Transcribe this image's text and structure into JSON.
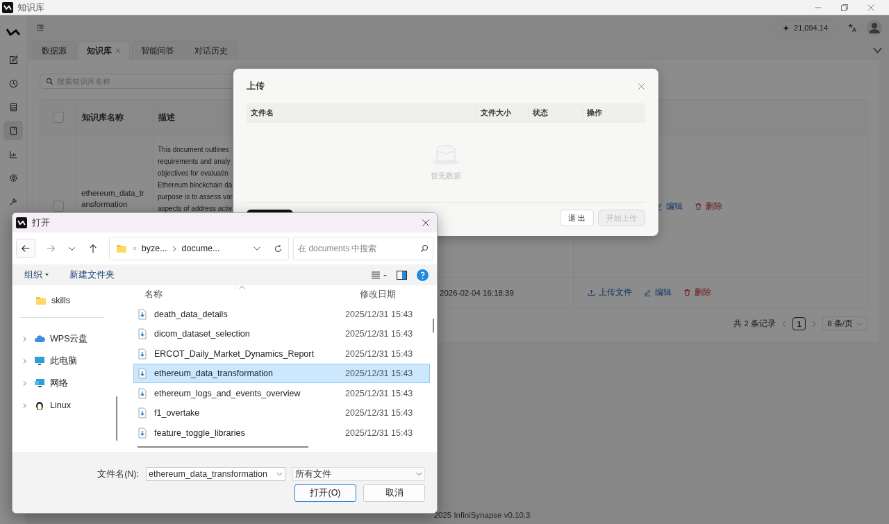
{
  "window": {
    "title": "知识库"
  },
  "rail": {
    "items": [
      {
        "kind": "edit",
        "selected": false
      },
      {
        "kind": "history",
        "selected": false
      },
      {
        "kind": "list",
        "selected": false
      },
      {
        "kind": "book",
        "selected": true
      },
      {
        "kind": "chart",
        "selected": false
      },
      {
        "kind": "settings",
        "selected": false
      },
      {
        "kind": "tools",
        "selected": false
      }
    ]
  },
  "header": {
    "credits": "21,094.14"
  },
  "tabs": [
    {
      "label": "数据源",
      "selected": false,
      "closable": false
    },
    {
      "label": "知识库",
      "selected": true,
      "closable": true
    },
    {
      "label": "智能问答",
      "selected": false,
      "closable": false
    },
    {
      "label": "对话历史",
      "selected": false,
      "closable": false
    }
  ],
  "search": {
    "placeholder": "搜索知识库名称"
  },
  "table": {
    "all_checked": false,
    "columns": [
      "知识库名称",
      "描述"
    ],
    "rows": [
      {
        "checked": false,
        "name": "ethereum_data_transformation",
        "description_lines": [
          "This document outlines",
          "requirements and analy",
          "objectives for evaluatin",
          "Ethereum blockchain da",
          "purpose is to assess var",
          "aspects of address activ"
        ],
        "actions": [
          {
            "kind": "edit",
            "label": "编辑"
          },
          {
            "kind": "delete",
            "label": "删除"
          }
        ]
      },
      {
        "updated": "2026-02-04 16:18:39",
        "actions": [
          {
            "kind": "upload",
            "label": "上传文件"
          },
          {
            "kind": "edit",
            "label": "编辑"
          },
          {
            "kind": "delete",
            "label": "删除"
          }
        ]
      }
    ]
  },
  "pagination": {
    "total": "共 2 条记录",
    "pages": [
      {
        "label": "1",
        "selected": true
      }
    ],
    "page_size": "8 条/页"
  },
  "footer": "2025 InfiniSynapse v0.10.3",
  "upload_dialog": {
    "title": "上传",
    "columns": [
      "文件名",
      "文件大小",
      "状态",
      "操作"
    ],
    "empty_text": "暂无数据",
    "buttons": [
      {
        "label": "退 出",
        "disabled": false
      },
      {
        "label": "开始上传",
        "disabled": true
      }
    ]
  },
  "open_dialog": {
    "title": "打开",
    "path": [
      "byze...",
      "docume..."
    ],
    "search_placeholder": "在 documents 中搜索",
    "toolbar": [
      "组织",
      "新建文件夹"
    ],
    "nav": [
      {
        "kind": "folder",
        "label": "skills",
        "expandable": false
      },
      {
        "kind": "cloud",
        "label": "WPS云盘",
        "expandable": true
      },
      {
        "kind": "computer",
        "label": "此电脑",
        "expandable": true
      },
      {
        "kind": "network",
        "label": "网络",
        "expandable": true
      },
      {
        "kind": "linux",
        "label": "Linux",
        "expandable": true
      }
    ],
    "columns": [
      "名称",
      "修改日期"
    ],
    "files": [
      {
        "name": "death_data_details",
        "modified": "2025/12/31 15:43",
        "selected": false
      },
      {
        "name": "dicom_dataset_selection",
        "modified": "2025/12/31 15:43",
        "selected": false
      },
      {
        "name": "ERCOT_Daily_Market_Dynamics_Report",
        "modified": "2025/12/31 15:43",
        "selected": false
      },
      {
        "name": "ethereum_data_transformation",
        "modified": "2025/12/31 15:43",
        "selected": true
      },
      {
        "name": "ethereum_logs_and_events_overview",
        "modified": "2025/12/31 15:43",
        "selected": false
      },
      {
        "name": "f1_overtake",
        "modified": "2025/12/31 15:43",
        "selected": false
      },
      {
        "name": "feature_toggle_libraries",
        "modified": "2025/12/31 15:43",
        "selected": false
      }
    ],
    "filename_label": "文件名(N):",
    "filename": "ethereum_data_transformation",
    "filetype": "所有文件",
    "buttons": [
      {
        "label": "打开(O)",
        "primary": true
      },
      {
        "label": "取消",
        "primary": false
      }
    ]
  }
}
